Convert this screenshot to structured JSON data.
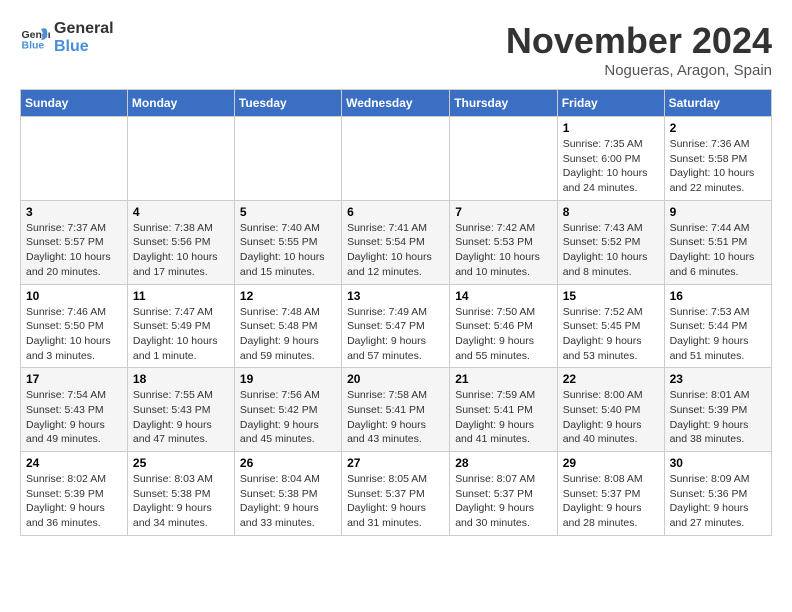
{
  "header": {
    "logo_text_general": "General",
    "logo_text_blue": "Blue",
    "month_year": "November 2024",
    "location": "Nogueras, Aragon, Spain"
  },
  "weekdays": [
    "Sunday",
    "Monday",
    "Tuesday",
    "Wednesday",
    "Thursday",
    "Friday",
    "Saturday"
  ],
  "weeks": [
    [
      {
        "day": "",
        "info": ""
      },
      {
        "day": "",
        "info": ""
      },
      {
        "day": "",
        "info": ""
      },
      {
        "day": "",
        "info": ""
      },
      {
        "day": "",
        "info": ""
      },
      {
        "day": "1",
        "info": "Sunrise: 7:35 AM\nSunset: 6:00 PM\nDaylight: 10 hours\nand 24 minutes."
      },
      {
        "day": "2",
        "info": "Sunrise: 7:36 AM\nSunset: 5:58 PM\nDaylight: 10 hours\nand 22 minutes."
      }
    ],
    [
      {
        "day": "3",
        "info": "Sunrise: 7:37 AM\nSunset: 5:57 PM\nDaylight: 10 hours\nand 20 minutes."
      },
      {
        "day": "4",
        "info": "Sunrise: 7:38 AM\nSunset: 5:56 PM\nDaylight: 10 hours\nand 17 minutes."
      },
      {
        "day": "5",
        "info": "Sunrise: 7:40 AM\nSunset: 5:55 PM\nDaylight: 10 hours\nand 15 minutes."
      },
      {
        "day": "6",
        "info": "Sunrise: 7:41 AM\nSunset: 5:54 PM\nDaylight: 10 hours\nand 12 minutes."
      },
      {
        "day": "7",
        "info": "Sunrise: 7:42 AM\nSunset: 5:53 PM\nDaylight: 10 hours\nand 10 minutes."
      },
      {
        "day": "8",
        "info": "Sunrise: 7:43 AM\nSunset: 5:52 PM\nDaylight: 10 hours\nand 8 minutes."
      },
      {
        "day": "9",
        "info": "Sunrise: 7:44 AM\nSunset: 5:51 PM\nDaylight: 10 hours\nand 6 minutes."
      }
    ],
    [
      {
        "day": "10",
        "info": "Sunrise: 7:46 AM\nSunset: 5:50 PM\nDaylight: 10 hours\nand 3 minutes."
      },
      {
        "day": "11",
        "info": "Sunrise: 7:47 AM\nSunset: 5:49 PM\nDaylight: 10 hours\nand 1 minute."
      },
      {
        "day": "12",
        "info": "Sunrise: 7:48 AM\nSunset: 5:48 PM\nDaylight: 9 hours\nand 59 minutes."
      },
      {
        "day": "13",
        "info": "Sunrise: 7:49 AM\nSunset: 5:47 PM\nDaylight: 9 hours\nand 57 minutes."
      },
      {
        "day": "14",
        "info": "Sunrise: 7:50 AM\nSunset: 5:46 PM\nDaylight: 9 hours\nand 55 minutes."
      },
      {
        "day": "15",
        "info": "Sunrise: 7:52 AM\nSunset: 5:45 PM\nDaylight: 9 hours\nand 53 minutes."
      },
      {
        "day": "16",
        "info": "Sunrise: 7:53 AM\nSunset: 5:44 PM\nDaylight: 9 hours\nand 51 minutes."
      }
    ],
    [
      {
        "day": "17",
        "info": "Sunrise: 7:54 AM\nSunset: 5:43 PM\nDaylight: 9 hours\nand 49 minutes."
      },
      {
        "day": "18",
        "info": "Sunrise: 7:55 AM\nSunset: 5:43 PM\nDaylight: 9 hours\nand 47 minutes."
      },
      {
        "day": "19",
        "info": "Sunrise: 7:56 AM\nSunset: 5:42 PM\nDaylight: 9 hours\nand 45 minutes."
      },
      {
        "day": "20",
        "info": "Sunrise: 7:58 AM\nSunset: 5:41 PM\nDaylight: 9 hours\nand 43 minutes."
      },
      {
        "day": "21",
        "info": "Sunrise: 7:59 AM\nSunset: 5:41 PM\nDaylight: 9 hours\nand 41 minutes."
      },
      {
        "day": "22",
        "info": "Sunrise: 8:00 AM\nSunset: 5:40 PM\nDaylight: 9 hours\nand 40 minutes."
      },
      {
        "day": "23",
        "info": "Sunrise: 8:01 AM\nSunset: 5:39 PM\nDaylight: 9 hours\nand 38 minutes."
      }
    ],
    [
      {
        "day": "24",
        "info": "Sunrise: 8:02 AM\nSunset: 5:39 PM\nDaylight: 9 hours\nand 36 minutes."
      },
      {
        "day": "25",
        "info": "Sunrise: 8:03 AM\nSunset: 5:38 PM\nDaylight: 9 hours\nand 34 minutes."
      },
      {
        "day": "26",
        "info": "Sunrise: 8:04 AM\nSunset: 5:38 PM\nDaylight: 9 hours\nand 33 minutes."
      },
      {
        "day": "27",
        "info": "Sunrise: 8:05 AM\nSunset: 5:37 PM\nDaylight: 9 hours\nand 31 minutes."
      },
      {
        "day": "28",
        "info": "Sunrise: 8:07 AM\nSunset: 5:37 PM\nDaylight: 9 hours\nand 30 minutes."
      },
      {
        "day": "29",
        "info": "Sunrise: 8:08 AM\nSunset: 5:37 PM\nDaylight: 9 hours\nand 28 minutes."
      },
      {
        "day": "30",
        "info": "Sunrise: 8:09 AM\nSunset: 5:36 PM\nDaylight: 9 hours\nand 27 minutes."
      }
    ]
  ]
}
